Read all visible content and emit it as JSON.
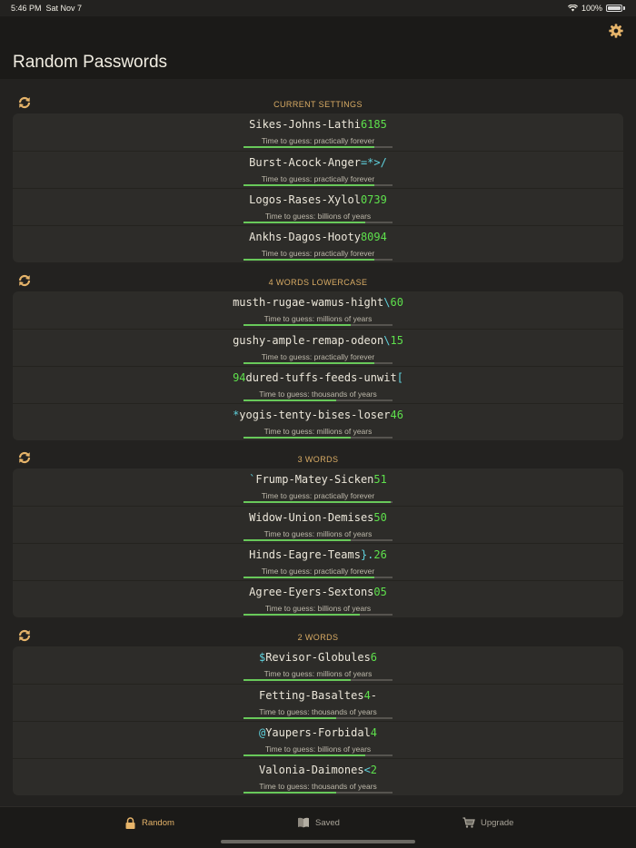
{
  "status": {
    "time": "5:46 PM",
    "date": "Sat Nov 7",
    "battery": "100%"
  },
  "nav": {
    "title": "Random Passwords"
  },
  "colors": {
    "accent": "#e6b46a",
    "number": "#5ee04c",
    "symbol": "#5fd2de",
    "strength": "#68c95a"
  },
  "sections": [
    {
      "title": "CURRENT SETTINGS",
      "items": [
        {
          "parts": [
            {
              "t": "Sikes-Johns-Lathi",
              "c": "w"
            },
            {
              "t": "6185",
              "c": "n"
            }
          ],
          "guess": "Time to guess: practically forever",
          "strength": 0.88
        },
        {
          "parts": [
            {
              "t": "Burst-Acock-Anger",
              "c": "w"
            },
            {
              "t": "=*>/",
              "c": "s"
            }
          ],
          "guess": "Time to guess: practically forever",
          "strength": 0.88
        },
        {
          "parts": [
            {
              "t": "Logos-Rases-Xylol",
              "c": "w"
            },
            {
              "t": "0739",
              "c": "n"
            }
          ],
          "guess": "Time to guess: billions of years",
          "strength": 0.82
        },
        {
          "parts": [
            {
              "t": "Ankhs-Dagos-Hooty",
              "c": "w"
            },
            {
              "t": "8094",
              "c": "n"
            }
          ],
          "guess": "Time to guess: practically forever",
          "strength": 0.88
        }
      ]
    },
    {
      "title": "4 WORDS LOWERCASE",
      "items": [
        {
          "parts": [
            {
              "t": "musth-rugae-wamus-hight",
              "c": "w"
            },
            {
              "t": "\\",
              "c": "s"
            },
            {
              "t": "60",
              "c": "n"
            }
          ],
          "guess": "Time to guess: millions of years",
          "strength": 0.72
        },
        {
          "parts": [
            {
              "t": "gushy-ample-remap-odeon",
              "c": "w"
            },
            {
              "t": "\\",
              "c": "s"
            },
            {
              "t": "15",
              "c": "n"
            }
          ],
          "guess": "Time to guess: practically forever",
          "strength": 0.88
        },
        {
          "parts": [
            {
              "t": "94",
              "c": "n"
            },
            {
              "t": "dured-tuffs-feeds-unwit",
              "c": "w"
            },
            {
              "t": "[",
              "c": "s"
            }
          ],
          "guess": "Time to guess: thousands of years",
          "strength": 0.62
        },
        {
          "parts": [
            {
              "t": "*",
              "c": "s"
            },
            {
              "t": "yogis-tenty-bises-loser",
              "c": "w"
            },
            {
              "t": "46",
              "c": "n"
            }
          ],
          "guess": "Time to guess: millions of years",
          "strength": 0.72
        }
      ]
    },
    {
      "title": "3 WORDS",
      "items": [
        {
          "parts": [
            {
              "t": "`",
              "c": "s"
            },
            {
              "t": "Frump-Matey-Sicken",
              "c": "w"
            },
            {
              "t": "51",
              "c": "n"
            }
          ],
          "guess": "Time to guess: practically forever",
          "strength": 0.99
        },
        {
          "parts": [
            {
              "t": "Widow-Union-Demises",
              "c": "w"
            },
            {
              "t": "50",
              "c": "n"
            }
          ],
          "guess": "Time to guess: millions of years",
          "strength": 0.72
        },
        {
          "parts": [
            {
              "t": "Hinds-Eagre-Teams",
              "c": "w"
            },
            {
              "t": "}.",
              "c": "s"
            },
            {
              "t": "26",
              "c": "n"
            }
          ],
          "guess": "Time to guess: practically forever",
          "strength": 0.88
        },
        {
          "parts": [
            {
              "t": "Agree-Eyers-Sextons",
              "c": "w"
            },
            {
              "t": "05",
              "c": "n"
            }
          ],
          "guess": "Time to guess: billions of years",
          "strength": 0.78
        }
      ]
    },
    {
      "title": "2 WORDS",
      "items": [
        {
          "parts": [
            {
              "t": "$",
              "c": "s"
            },
            {
              "t": "Revisor-Globules",
              "c": "w"
            },
            {
              "t": "6",
              "c": "n"
            }
          ],
          "guess": "Time to guess: millions of years",
          "strength": 0.72
        },
        {
          "parts": [
            {
              "t": "Fetting-Basaltes",
              "c": "w"
            },
            {
              "t": "4",
              "c": "n"
            },
            {
              "t": "-",
              "c": "w"
            }
          ],
          "guess": "Time to guess: thousands of years",
          "strength": 0.62
        },
        {
          "parts": [
            {
              "t": "@",
              "c": "s"
            },
            {
              "t": "Yaupers-Forbidal",
              "c": "w"
            },
            {
              "t": "4",
              "c": "n"
            }
          ],
          "guess": "Time to guess: billions of years",
          "strength": 0.82
        },
        {
          "parts": [
            {
              "t": "Valonia-Daimones",
              "c": "w"
            },
            {
              "t": "<",
              "c": "s"
            },
            {
              "t": "2",
              "c": "n"
            }
          ],
          "guess": "Time to guess: thousands of years",
          "strength": 0.62
        }
      ]
    }
  ],
  "tabs": [
    {
      "label": "Random",
      "icon": "lock-icon",
      "active": true
    },
    {
      "label": "Saved",
      "icon": "book-icon",
      "active": false
    },
    {
      "label": "Upgrade",
      "icon": "cart-icon",
      "active": false
    }
  ]
}
